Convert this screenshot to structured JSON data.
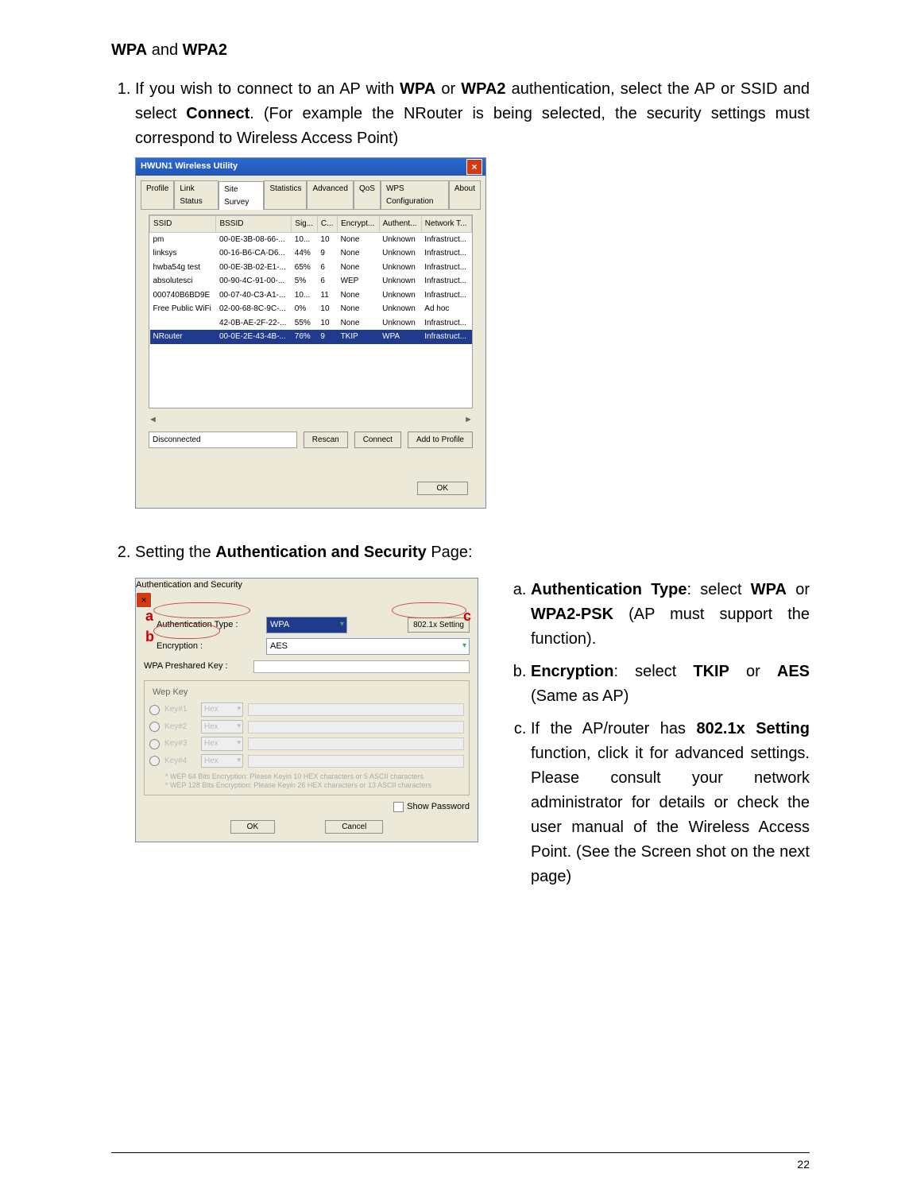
{
  "page_number": "22",
  "section": {
    "title_prefix": "WPA",
    "title_mid": " and ",
    "title_suffix": "WPA2"
  },
  "step1_lead": "If you wish to connect to an AP with ",
  "step1_b1": "WPA",
  "step1_mid1": " or ",
  "step1_b2": "WPA2",
  "step1_mid2": " authentication, select the AP or SSID and select ",
  "step1_b3": "Connect",
  "step1_tail": ".  (For example the NRouter is being selected, the security settings must correspond to Wireless Access Point)",
  "step2": {
    "lead": "Setting the ",
    "bold": "Authentication and Security",
    "tail": " Page:"
  },
  "win1": {
    "title": "HWUN1 Wireless Utility",
    "tabs": [
      "Profile",
      "Link Status",
      "Site Survey",
      "Statistics",
      "Advanced",
      "QoS",
      "WPS Configuration",
      "About"
    ],
    "active_tab": 2,
    "columns": [
      "SSID",
      "BSSID",
      "Sig...",
      "C...",
      "Encrypt...",
      "Authent...",
      "Network T..."
    ],
    "rows": [
      {
        "ssid": "pm",
        "bssid": "00-0E-3B-08-66-...",
        "sig": "10...",
        "ch": "10",
        "enc": "None",
        "auth": "Unknown",
        "net": "Infrastruct..."
      },
      {
        "ssid": "linksys",
        "bssid": "00-16-B6-CA-D6...",
        "sig": "44%",
        "ch": "9",
        "enc": "None",
        "auth": "Unknown",
        "net": "Infrastruct..."
      },
      {
        "ssid": "hwba54g test",
        "bssid": "00-0E-3B-02-E1-...",
        "sig": "65%",
        "ch": "6",
        "enc": "None",
        "auth": "Unknown",
        "net": "Infrastruct..."
      },
      {
        "ssid": "absolutesci",
        "bssid": "00-90-4C-91-00-...",
        "sig": "5%",
        "ch": "6",
        "enc": "WEP",
        "auth": "Unknown",
        "net": "Infrastruct..."
      },
      {
        "ssid": "000740B6BD9E",
        "bssid": "00-07-40-C3-A1-...",
        "sig": "10...",
        "ch": "11",
        "enc": "None",
        "auth": "Unknown",
        "net": "Infrastruct..."
      },
      {
        "ssid": "Free Public WiFi",
        "bssid": "02-00-68-8C-9C-...",
        "sig": "0%",
        "ch": "10",
        "enc": "None",
        "auth": "Unknown",
        "net": "Ad hoc"
      },
      {
        "ssid": "",
        "bssid": "42-0B-AE-2F-22-...",
        "sig": "55%",
        "ch": "10",
        "enc": "None",
        "auth": "Unknown",
        "net": "Infrastruct..."
      },
      {
        "ssid": "NRouter",
        "bssid": "00-0E-2E-43-4B-...",
        "sig": "76%",
        "ch": "9",
        "enc": "TKIP",
        "auth": "WPA",
        "net": "Infrastruct..."
      }
    ],
    "selected_index": 7,
    "status": "Disconnected",
    "buttons": {
      "rescan": "Rescan",
      "connect": "Connect",
      "add": "Add to Profile",
      "ok": "OK"
    }
  },
  "win2": {
    "title": "Authentication and Security",
    "auth_label": "Authentication Type :",
    "auth_value": "WPA",
    "btn802": "802.1x Setting",
    "enc_label": "Encryption :",
    "enc_value": "AES",
    "psk_label": "WPA Preshared Key :",
    "wep_title": "Wep Key",
    "wep_keys": [
      {
        "name": "Key#1",
        "fmt": "Hex"
      },
      {
        "name": "Key#2",
        "fmt": "Hex"
      },
      {
        "name": "Key#3",
        "fmt": "Hex"
      },
      {
        "name": "Key#4",
        "fmt": "Hex"
      }
    ],
    "note1": "* WEP 64 Bits Encryption:  Please Keyin 10 HEX characters or 5 ASCII characters",
    "note2": "* WEP 128 Bits Encryption:  Please Keyin 26 HEX characters or 13 ASCII characters",
    "show_pw": "Show Password",
    "ok": "OK",
    "cancel": "Cancel",
    "callouts": {
      "a": "a",
      "b": "b",
      "c": "c"
    }
  },
  "rightcol": {
    "a_lead": "Authentication Type",
    "a_mid": ": select ",
    "a_b1": "WPA",
    "a_mid2": " or ",
    "a_b2": "WPA2-PSK",
    "a_tail": "  (AP must support the function).",
    "b_lead": "Encryption",
    "b_mid": ": select ",
    "b_b1": "TKIP",
    "b_mid2": " or ",
    "b_b2": "AES",
    "b_tail": " (Same as AP)",
    "c_lead": "If the AP/router has ",
    "c_b1": "802.1x Setting",
    "c_tail": " function, click it for advanced settings. Please consult your network administrator for details or check the user manual of the Wireless Access Point. (See the Screen shot on the next page)"
  }
}
